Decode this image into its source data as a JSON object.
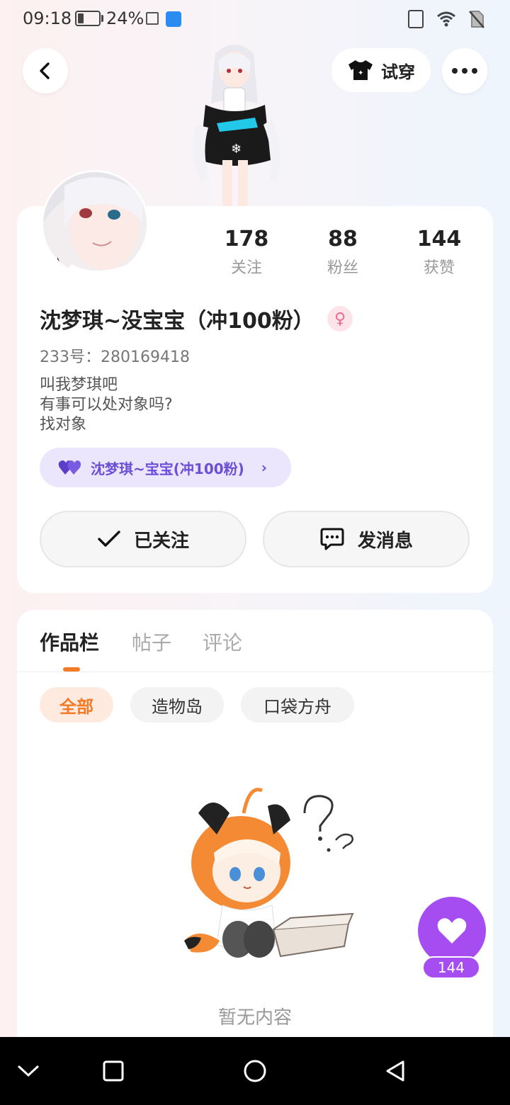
{
  "status_bar": {
    "time": "09:18",
    "battery_percent": "24%",
    "icons": [
      "battery-icon",
      "screenshot-icon",
      "app-notification-icon",
      "vibrate-icon",
      "wifi-icon",
      "no-sim-icon"
    ]
  },
  "header": {
    "try_on_label": "试穿",
    "icons": [
      "back-arrow-icon",
      "tshirt-icon",
      "more-dots-icon"
    ]
  },
  "profile": {
    "stats": [
      {
        "value": "178",
        "label": "关注"
      },
      {
        "value": "88",
        "label": "粉丝"
      },
      {
        "value": "144",
        "label": "获赞"
      }
    ],
    "username": "沈梦琪~没宝宝（冲100粉）",
    "gender_icon": "female-icon",
    "uid": "233号：280169418",
    "bio_lines": [
      "叫我梦琪吧",
      "有事可以处对象吗?",
      "找对象"
    ],
    "group_label": "沈梦琪~宝宝(冲100粉)",
    "follow_label": "已关注",
    "message_label": "发消息"
  },
  "content": {
    "tabs": [
      "作品栏",
      "帖子",
      "评论"
    ],
    "active_tab": "作品栏",
    "filters": [
      "全部",
      "造物岛",
      "口袋方舟"
    ],
    "active_filter": "全部",
    "empty_text": "暂无内容"
  },
  "like_fab": {
    "count": "144",
    "icon": "heart-icon"
  },
  "nav_bar": {
    "icons": [
      "nav-hide-icon",
      "nav-recents-icon",
      "nav-home-icon",
      "nav-back-icon"
    ]
  },
  "colors": {
    "accent_orange": "#f47a26",
    "accent_purple": "#a64df2",
    "group_pill_bg": "#ebe6fb",
    "group_pill_text": "#6a4fd8"
  }
}
